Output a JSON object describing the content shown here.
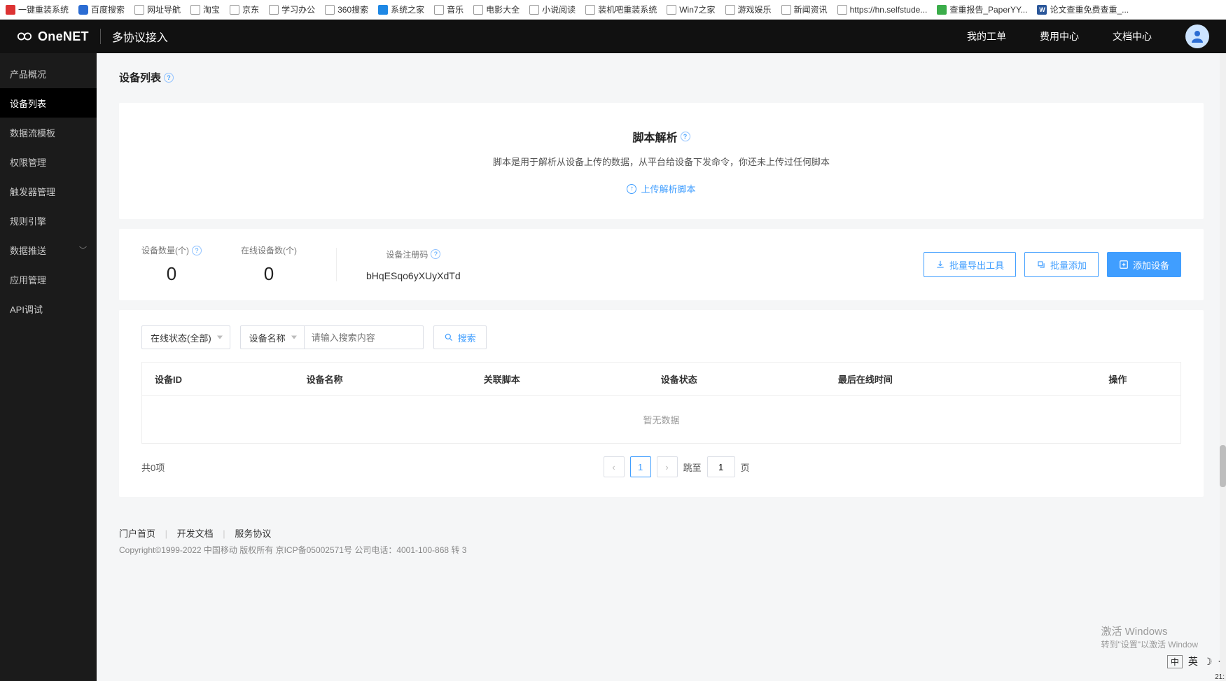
{
  "bookmarks": [
    {
      "label": "一键重装系统",
      "icon": "b-red"
    },
    {
      "label": "百度搜索",
      "icon": "b-baidu"
    },
    {
      "label": "网址导航",
      "icon": ""
    },
    {
      "label": "淘宝",
      "icon": ""
    },
    {
      "label": "京东",
      "icon": ""
    },
    {
      "label": "学习办公",
      "icon": ""
    },
    {
      "label": "360搜索",
      "icon": ""
    },
    {
      "label": "系统之家",
      "icon": "b-blue"
    },
    {
      "label": "音乐",
      "icon": ""
    },
    {
      "label": "电影大全",
      "icon": ""
    },
    {
      "label": "小说阅读",
      "icon": ""
    },
    {
      "label": "装机吧重装系统",
      "icon": ""
    },
    {
      "label": "Win7之家",
      "icon": ""
    },
    {
      "label": "游戏娱乐",
      "icon": ""
    },
    {
      "label": "新闻资讯",
      "icon": ""
    },
    {
      "label": "https://hn.selfstude...",
      "icon": ""
    },
    {
      "label": "查重报告_PaperYY...",
      "icon": "b-green"
    },
    {
      "label": "论文查重免费查重_...",
      "icon": "b-w",
      "ictext": "W"
    }
  ],
  "header": {
    "brand": "OneNET",
    "sub": "多协议接入",
    "links": [
      "我的工单",
      "费用中心",
      "文档中心"
    ]
  },
  "sidebar": [
    {
      "label": "产品概况"
    },
    {
      "label": "设备列表",
      "active": true
    },
    {
      "label": "数据流模板"
    },
    {
      "label": "权限管理"
    },
    {
      "label": "触发器管理"
    },
    {
      "label": "规则引擎"
    },
    {
      "label": "数据推送",
      "hasChildren": true
    },
    {
      "label": "应用管理"
    },
    {
      "label": "API调试"
    }
  ],
  "page": {
    "title": "设备列表"
  },
  "scriptPanel": {
    "title": "脚本解析",
    "desc": "脚本是用于解析从设备上传的数据，从平台给设备下发命令，你还未上传过任何脚本",
    "uploadLabel": "上传解析脚本"
  },
  "stats": {
    "count": {
      "label": "设备数量(个)",
      "value": "0"
    },
    "online": {
      "label": "在线设备数(个)",
      "value": "0"
    },
    "reg": {
      "label": "设备注册码",
      "value": "bHqESqo6yXUyXdTd"
    }
  },
  "statBtns": {
    "export": "批量导出工具",
    "batchAdd": "批量添加",
    "add": "添加设备"
  },
  "filters": {
    "statusSel": "在线状态(全部)",
    "nameSel": "设备名称",
    "placeholder": "请输入搜索内容",
    "searchBtn": "搜索"
  },
  "table": {
    "cols": [
      "设备ID",
      "设备名称",
      "关联脚本",
      "设备状态",
      "最后在线时间",
      "操作"
    ],
    "empty": "暂无数据"
  },
  "pager": {
    "total": "共0项",
    "page": "1",
    "jumpLabel": "跳至",
    "jumpVal": "1",
    "pageSuffix": "页"
  },
  "footer": {
    "links": [
      "门户首页",
      "开发文档",
      "服务协议"
    ],
    "copyright": "Copyright©1999-2022 中国移动 版权所有 京ICP备05002571号 公司电话：4001-100-868 转 3"
  },
  "winActivate": {
    "l1": "激活 Windows",
    "l2": "转到\"设置\"以激活 Window"
  },
  "ime": {
    "lang": "英",
    "mode": "中"
  },
  "clock": "21:"
}
